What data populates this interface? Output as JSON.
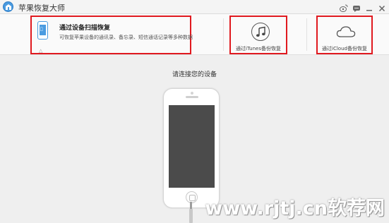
{
  "app": {
    "title": "苹果恢复大师"
  },
  "toolbar": {
    "device_scan": {
      "title": "通过设备扫描恢复",
      "description": "可恢复苹果设备的通讯录、备忘录、短信通话记录等多种数据",
      "icon": "iphone-icon"
    },
    "itunes": {
      "label": "通过iTunes备份恢复",
      "icon": "music-note-icon"
    },
    "icloud": {
      "label": "通过iCloud备份恢复",
      "icon": "cloud-icon"
    }
  },
  "main": {
    "prompt": "请连接您的设备"
  },
  "watermark": {
    "text": "www.rjtj.cn软荐网"
  },
  "colors": {
    "highlight_border": "#e0191f",
    "accent": "#4a9be0"
  }
}
